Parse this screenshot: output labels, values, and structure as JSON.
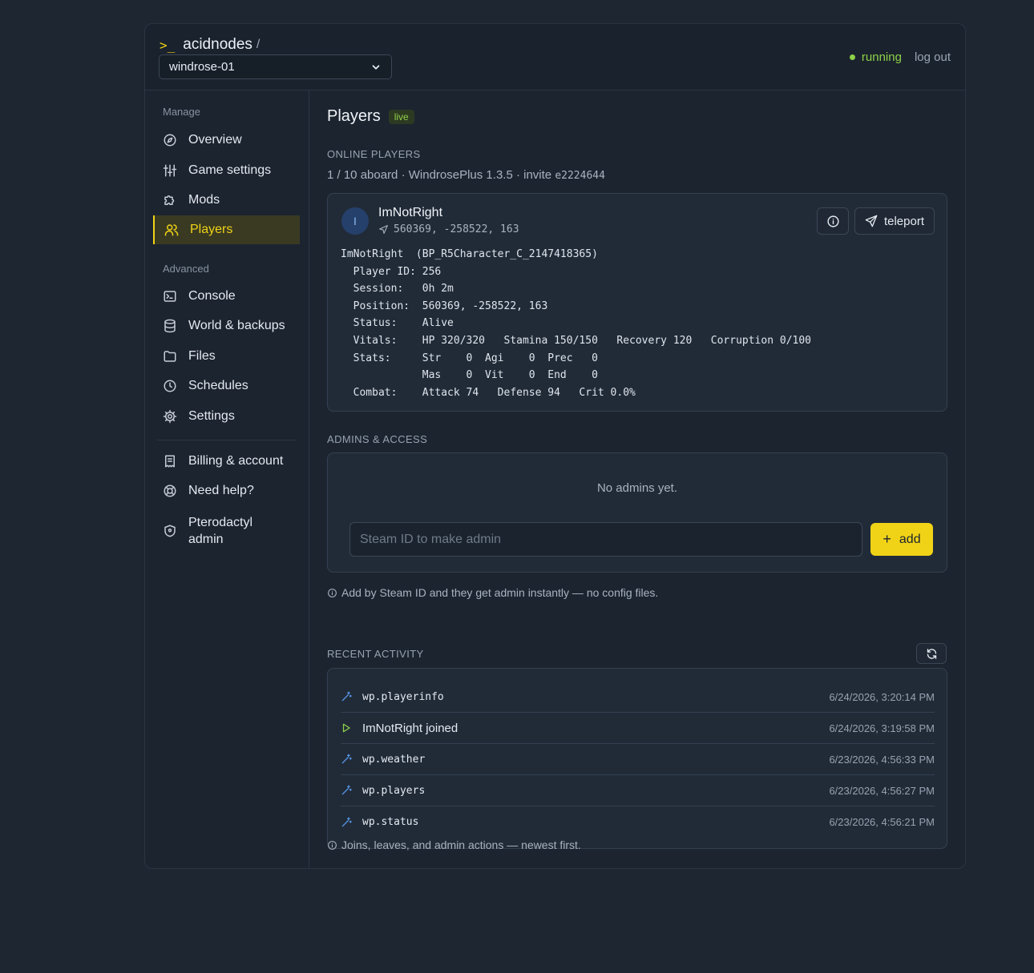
{
  "header": {
    "brand_prompt": ">_",
    "brand_name": "acidnodes",
    "brand_slash": "/",
    "server_selected": "windrose-01",
    "status": "running",
    "logout": "log out"
  },
  "sidebar": {
    "manage_label": "Manage",
    "advanced_label": "Advanced",
    "items": [
      {
        "label": "Overview",
        "icon": "compass-icon"
      },
      {
        "label": "Game settings",
        "icon": "sliders-icon"
      },
      {
        "label": "Mods",
        "icon": "puzzle-icon"
      },
      {
        "label": "Players",
        "icon": "users-icon",
        "active": true
      },
      {
        "label": "Console",
        "icon": "terminal-icon"
      },
      {
        "label": "World & backups",
        "icon": "database-icon"
      },
      {
        "label": "Files",
        "icon": "folder-icon"
      },
      {
        "label": "Schedules",
        "icon": "clock-icon"
      },
      {
        "label": "Settings",
        "icon": "gear-icon"
      },
      {
        "label": "Billing & account",
        "icon": "receipt-icon"
      },
      {
        "label": "Need help?",
        "icon": "lifebuoy-icon"
      },
      {
        "label_line1": "Pterodactyl",
        "label_line2": "admin",
        "icon": "shield-icon"
      }
    ]
  },
  "main": {
    "title": "Players",
    "live_badge": "live",
    "online_label": "ONLINE PLAYERS",
    "online_summary": "1 / 10 aboard · WindrosePlus 1.3.5 · invite ",
    "invite_code": "e2224644",
    "player": {
      "avatar_letter": "I",
      "name": "ImNotRight",
      "coords": "560369, -258522, 163",
      "teleport_label": "teleport",
      "info_lines": [
        "ImNotRight  (BP_R5Character_C_2147418365)",
        "  Player ID: 256",
        "  Session:   0h 2m",
        "  Position:  560369, -258522, 163",
        "  Status:    Alive",
        "  Vitals:    HP 320/320   Stamina 150/150   Recovery 120   Corruption 0/100",
        "  Stats:     Str    0  Agi    0  Prec   0",
        "             Mas    0  Vit    0  End    0",
        "  Combat:    Attack 74   Defense 94   Crit 0.0%"
      ]
    },
    "admins_label": "ADMINS & ACCESS",
    "no_admins": "No admins yet.",
    "admin_placeholder": "Steam ID to make admin",
    "add_label": "add",
    "admins_hint": "Add by Steam ID and they get admin instantly — no config files.",
    "activity_label": "RECENT ACTIVITY",
    "activity": [
      {
        "label": "wp.playerinfo",
        "time": "6/24/2026, 3:20:14 PM",
        "kind": "command"
      },
      {
        "label": "ImNotRight joined",
        "time": "6/24/2026, 3:19:58 PM",
        "kind": "join"
      },
      {
        "label": "wp.weather",
        "time": "6/23/2026, 4:56:33 PM",
        "kind": "command"
      },
      {
        "label": "wp.players",
        "time": "6/23/2026, 4:56:27 PM",
        "kind": "command"
      },
      {
        "label": "wp.status",
        "time": "6/23/2026, 4:56:21 PM",
        "kind": "command"
      }
    ],
    "activity_hint": "Joins, leaves, and admin actions — newest first."
  },
  "colors": {
    "accent": "#f0d316",
    "running": "#8ed048",
    "command_icon": "#5b9cf0",
    "join_icon": "#8ed048"
  }
}
